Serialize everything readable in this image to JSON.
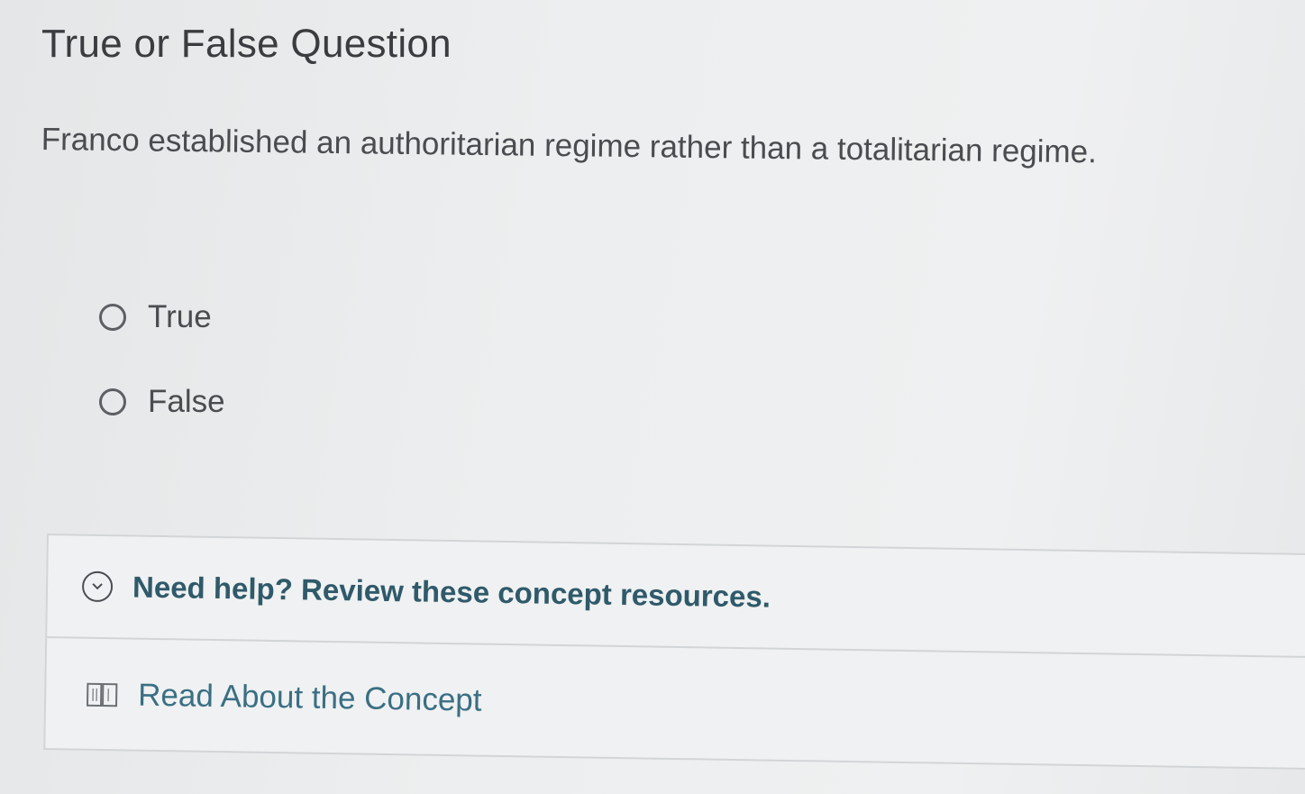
{
  "title": "True or False Question",
  "question": "Franco established an authoritarian regime rather than a totalitarian regime.",
  "options": [
    {
      "label": "True",
      "selected": false
    },
    {
      "label": "False",
      "selected": false
    }
  ],
  "help": {
    "header": "Need help? Review these concept resources.",
    "resources": [
      {
        "label": "Read About the Concept",
        "icon": "book-icon"
      }
    ]
  },
  "colors": {
    "help_text": "#2f5a6a",
    "link_text": "#3a6f84"
  }
}
